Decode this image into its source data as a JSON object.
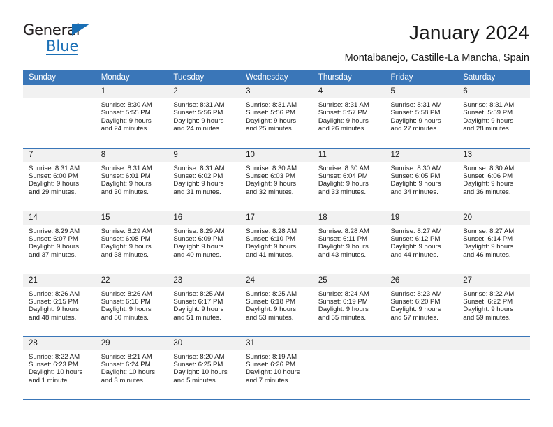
{
  "brand": {
    "name_line1": "General",
    "name_line2": "Blue",
    "triangle_icon": "triangle-icon",
    "accent_color": "#1a6fb5"
  },
  "header": {
    "title": "January 2024",
    "subtitle": "Montalbanejo, Castille-La Mancha, Spain"
  },
  "theme": {
    "header_row_color": "#3a76b8",
    "daynum_bg": "#f1f1f1",
    "text_color": "#1a1a1a"
  },
  "weekdays": [
    "Sunday",
    "Monday",
    "Tuesday",
    "Wednesday",
    "Thursday",
    "Friday",
    "Saturday"
  ],
  "weeks": [
    [
      {
        "day": "",
        "sunrise": "",
        "sunset": "",
        "daylight1": "",
        "daylight2": "",
        "empty": true
      },
      {
        "day": "1",
        "sunrise": "Sunrise: 8:30 AM",
        "sunset": "Sunset: 5:55 PM",
        "daylight1": "Daylight: 9 hours",
        "daylight2": "and 24 minutes."
      },
      {
        "day": "2",
        "sunrise": "Sunrise: 8:31 AM",
        "sunset": "Sunset: 5:56 PM",
        "daylight1": "Daylight: 9 hours",
        "daylight2": "and 24 minutes."
      },
      {
        "day": "3",
        "sunrise": "Sunrise: 8:31 AM",
        "sunset": "Sunset: 5:56 PM",
        "daylight1": "Daylight: 9 hours",
        "daylight2": "and 25 minutes."
      },
      {
        "day": "4",
        "sunrise": "Sunrise: 8:31 AM",
        "sunset": "Sunset: 5:57 PM",
        "daylight1": "Daylight: 9 hours",
        "daylight2": "and 26 minutes."
      },
      {
        "day": "5",
        "sunrise": "Sunrise: 8:31 AM",
        "sunset": "Sunset: 5:58 PM",
        "daylight1": "Daylight: 9 hours",
        "daylight2": "and 27 minutes."
      },
      {
        "day": "6",
        "sunrise": "Sunrise: 8:31 AM",
        "sunset": "Sunset: 5:59 PM",
        "daylight1": "Daylight: 9 hours",
        "daylight2": "and 28 minutes."
      }
    ],
    [
      {
        "day": "7",
        "sunrise": "Sunrise: 8:31 AM",
        "sunset": "Sunset: 6:00 PM",
        "daylight1": "Daylight: 9 hours",
        "daylight2": "and 29 minutes."
      },
      {
        "day": "8",
        "sunrise": "Sunrise: 8:31 AM",
        "sunset": "Sunset: 6:01 PM",
        "daylight1": "Daylight: 9 hours",
        "daylight2": "and 30 minutes."
      },
      {
        "day": "9",
        "sunrise": "Sunrise: 8:31 AM",
        "sunset": "Sunset: 6:02 PM",
        "daylight1": "Daylight: 9 hours",
        "daylight2": "and 31 minutes."
      },
      {
        "day": "10",
        "sunrise": "Sunrise: 8:30 AM",
        "sunset": "Sunset: 6:03 PM",
        "daylight1": "Daylight: 9 hours",
        "daylight2": "and 32 minutes."
      },
      {
        "day": "11",
        "sunrise": "Sunrise: 8:30 AM",
        "sunset": "Sunset: 6:04 PM",
        "daylight1": "Daylight: 9 hours",
        "daylight2": "and 33 minutes."
      },
      {
        "day": "12",
        "sunrise": "Sunrise: 8:30 AM",
        "sunset": "Sunset: 6:05 PM",
        "daylight1": "Daylight: 9 hours",
        "daylight2": "and 34 minutes."
      },
      {
        "day": "13",
        "sunrise": "Sunrise: 8:30 AM",
        "sunset": "Sunset: 6:06 PM",
        "daylight1": "Daylight: 9 hours",
        "daylight2": "and 36 minutes."
      }
    ],
    [
      {
        "day": "14",
        "sunrise": "Sunrise: 8:29 AM",
        "sunset": "Sunset: 6:07 PM",
        "daylight1": "Daylight: 9 hours",
        "daylight2": "and 37 minutes."
      },
      {
        "day": "15",
        "sunrise": "Sunrise: 8:29 AM",
        "sunset": "Sunset: 6:08 PM",
        "daylight1": "Daylight: 9 hours",
        "daylight2": "and 38 minutes."
      },
      {
        "day": "16",
        "sunrise": "Sunrise: 8:29 AM",
        "sunset": "Sunset: 6:09 PM",
        "daylight1": "Daylight: 9 hours",
        "daylight2": "and 40 minutes."
      },
      {
        "day": "17",
        "sunrise": "Sunrise: 8:28 AM",
        "sunset": "Sunset: 6:10 PM",
        "daylight1": "Daylight: 9 hours",
        "daylight2": "and 41 minutes."
      },
      {
        "day": "18",
        "sunrise": "Sunrise: 8:28 AM",
        "sunset": "Sunset: 6:11 PM",
        "daylight1": "Daylight: 9 hours",
        "daylight2": "and 43 minutes."
      },
      {
        "day": "19",
        "sunrise": "Sunrise: 8:27 AM",
        "sunset": "Sunset: 6:12 PM",
        "daylight1": "Daylight: 9 hours",
        "daylight2": "and 44 minutes."
      },
      {
        "day": "20",
        "sunrise": "Sunrise: 8:27 AM",
        "sunset": "Sunset: 6:14 PM",
        "daylight1": "Daylight: 9 hours",
        "daylight2": "and 46 minutes."
      }
    ],
    [
      {
        "day": "21",
        "sunrise": "Sunrise: 8:26 AM",
        "sunset": "Sunset: 6:15 PM",
        "daylight1": "Daylight: 9 hours",
        "daylight2": "and 48 minutes."
      },
      {
        "day": "22",
        "sunrise": "Sunrise: 8:26 AM",
        "sunset": "Sunset: 6:16 PM",
        "daylight1": "Daylight: 9 hours",
        "daylight2": "and 50 minutes."
      },
      {
        "day": "23",
        "sunrise": "Sunrise: 8:25 AM",
        "sunset": "Sunset: 6:17 PM",
        "daylight1": "Daylight: 9 hours",
        "daylight2": "and 51 minutes."
      },
      {
        "day": "24",
        "sunrise": "Sunrise: 8:25 AM",
        "sunset": "Sunset: 6:18 PM",
        "daylight1": "Daylight: 9 hours",
        "daylight2": "and 53 minutes."
      },
      {
        "day": "25",
        "sunrise": "Sunrise: 8:24 AM",
        "sunset": "Sunset: 6:19 PM",
        "daylight1": "Daylight: 9 hours",
        "daylight2": "and 55 minutes."
      },
      {
        "day": "26",
        "sunrise": "Sunrise: 8:23 AM",
        "sunset": "Sunset: 6:20 PM",
        "daylight1": "Daylight: 9 hours",
        "daylight2": "and 57 minutes."
      },
      {
        "day": "27",
        "sunrise": "Sunrise: 8:22 AM",
        "sunset": "Sunset: 6:22 PM",
        "daylight1": "Daylight: 9 hours",
        "daylight2": "and 59 minutes."
      }
    ],
    [
      {
        "day": "28",
        "sunrise": "Sunrise: 8:22 AM",
        "sunset": "Sunset: 6:23 PM",
        "daylight1": "Daylight: 10 hours",
        "daylight2": "and 1 minute."
      },
      {
        "day": "29",
        "sunrise": "Sunrise: 8:21 AM",
        "sunset": "Sunset: 6:24 PM",
        "daylight1": "Daylight: 10 hours",
        "daylight2": "and 3 minutes."
      },
      {
        "day": "30",
        "sunrise": "Sunrise: 8:20 AM",
        "sunset": "Sunset: 6:25 PM",
        "daylight1": "Daylight: 10 hours",
        "daylight2": "and 5 minutes."
      },
      {
        "day": "31",
        "sunrise": "Sunrise: 8:19 AM",
        "sunset": "Sunset: 6:26 PM",
        "daylight1": "Daylight: 10 hours",
        "daylight2": "and 7 minutes."
      },
      {
        "day": "",
        "sunrise": "",
        "sunset": "",
        "daylight1": "",
        "daylight2": "",
        "empty": true
      },
      {
        "day": "",
        "sunrise": "",
        "sunset": "",
        "daylight1": "",
        "daylight2": "",
        "empty": true
      },
      {
        "day": "",
        "sunrise": "",
        "sunset": "",
        "daylight1": "",
        "daylight2": "",
        "empty": true
      }
    ]
  ]
}
